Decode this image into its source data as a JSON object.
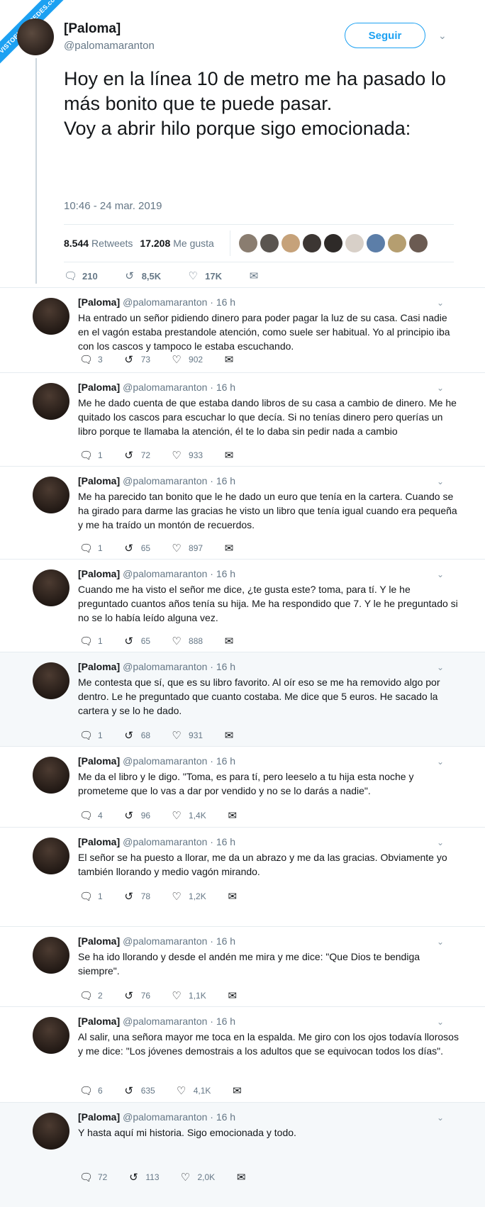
{
  "watermark": "VISTOENLASREDES.com",
  "main": {
    "name": "[Paloma]",
    "handle": "@palomamaranton",
    "follow_label": "Seguir",
    "text": "Hoy en la línea 10 de metro me ha pasado lo más bonito que te puede pasar.\nVoy a abrir hilo porque sigo emocionada:",
    "timestamp": "10:46 - 24 mar. 2019",
    "retweets_count": "8.544",
    "retweets_label": "Retweets",
    "likes_count": "17.208",
    "likes_label": "Me gusta",
    "actions": {
      "replies": "210",
      "retweets": "8,5K",
      "likes": "17K"
    },
    "liker_colors": [
      "#8a7d70",
      "#5a5550",
      "#c6a27a",
      "#3c3633",
      "#2e2a28",
      "#d8d0c8",
      "#5c7ea8",
      "#b59e70",
      "#6b5b52"
    ]
  },
  "replies": [
    {
      "name": "[Paloma]",
      "handle": "@palomamaranton",
      "time": "· 16 h",
      "text": "Ha entrado un señor pidiendo dinero para poder pagar la luz de su casa. Casi nadie en el vagón estaba prestandole atención, como suele ser habitual. Yo al principio iba con los cascos y tampoco le estaba escuchando.",
      "replies": "3",
      "retweets": "73",
      "likes": "902"
    },
    {
      "name": "[Paloma]",
      "handle": "@palomamaranton",
      "time": "· 16 h",
      "text": "Me he dado cuenta de que estaba dando libros de su casa a cambio de dinero. Me he quitado los cascos para escuchar lo que decía. Si no tenías dinero pero querías un libro porque te llamaba la atención, él te lo daba sin pedir nada a cambio",
      "replies": "1",
      "retweets": "72",
      "likes": "933"
    },
    {
      "name": "[Paloma]",
      "handle": "@palomamaranton",
      "time": "· 16 h",
      "text": "Me ha parecido tan bonito que le he dado un euro que tenía en la cartera. Cuando se ha girado para darme las gracias he visto un libro que tenía igual cuando era pequeña y me ha traído un montón de recuerdos.",
      "replies": "1",
      "retweets": "65",
      "likes": "897"
    },
    {
      "name": "[Paloma]",
      "handle": "@palomamaranton",
      "time": "· 16 h",
      "text": "Cuando me ha visto el señor me dice, ¿te gusta este? toma, para tí. Y le he preguntado cuantos años tenía su hija. Me ha respondido que 7. Y le he preguntado si no se lo había leído alguna vez.",
      "replies": "1",
      "retweets": "65",
      "likes": "888"
    },
    {
      "name": "[Paloma]",
      "handle": "@palomamaranton",
      "time": "· 16 h",
      "text": "Me contesta que sí, que es su libro favorito. Al oír eso se me ha removido algo por dentro. Le he preguntado que cuanto costaba. Me dice que 5 euros. He sacado la cartera y se lo he dado.",
      "replies": "1",
      "retweets": "68",
      "likes": "931"
    },
    {
      "name": "[Paloma]",
      "handle": "@palomamaranton",
      "time": "· 16 h",
      "text": "Me da el libro y le digo. \"Toma, es para tí, pero leeselo a tu hija esta noche y prometeme que lo vas a dar por vendido y no se lo darás a nadie\".",
      "replies": "4",
      "retweets": "96",
      "likes": "1,4K"
    },
    {
      "name": "[Paloma]",
      "handle": "@palomamaranton",
      "time": "· 16 h",
      "text": "El señor se ha puesto a llorar, me da un abrazo y me da las gracias. Obviamente yo también llorando y medio vagón mirando.",
      "replies": "1",
      "retweets": "78",
      "likes": "1,2K"
    },
    {
      "name": "[Paloma]",
      "handle": "@palomamaranton",
      "time": "· 16 h",
      "text": "Se ha ido llorando y desde el andén me mira y me dice: \"Que Dios te bendiga siempre\".",
      "replies": "2",
      "retweets": "76",
      "likes": "1,1K"
    },
    {
      "name": "[Paloma]",
      "handle": "@palomamaranton",
      "time": "· 16 h",
      "text": "Al salir, una señora mayor me toca en la espalda. Me giro con los ojos todavía llorosos y me dice: \"Los jóvenes demostrais a los adultos que se equivocan todos los días\".",
      "replies": "6",
      "retweets": "635",
      "likes": "4,1K"
    },
    {
      "name": "[Paloma]",
      "handle": "@palomamaranton",
      "time": "· 16 h",
      "text": "Y hasta aquí mi historia. Sigo emocionada y todo.",
      "replies": "72",
      "retweets": "113",
      "likes": "2,0K"
    }
  ],
  "colors": {
    "accent": "#1da1f2",
    "muted": "#657786",
    "border": "#e6ecf0"
  }
}
